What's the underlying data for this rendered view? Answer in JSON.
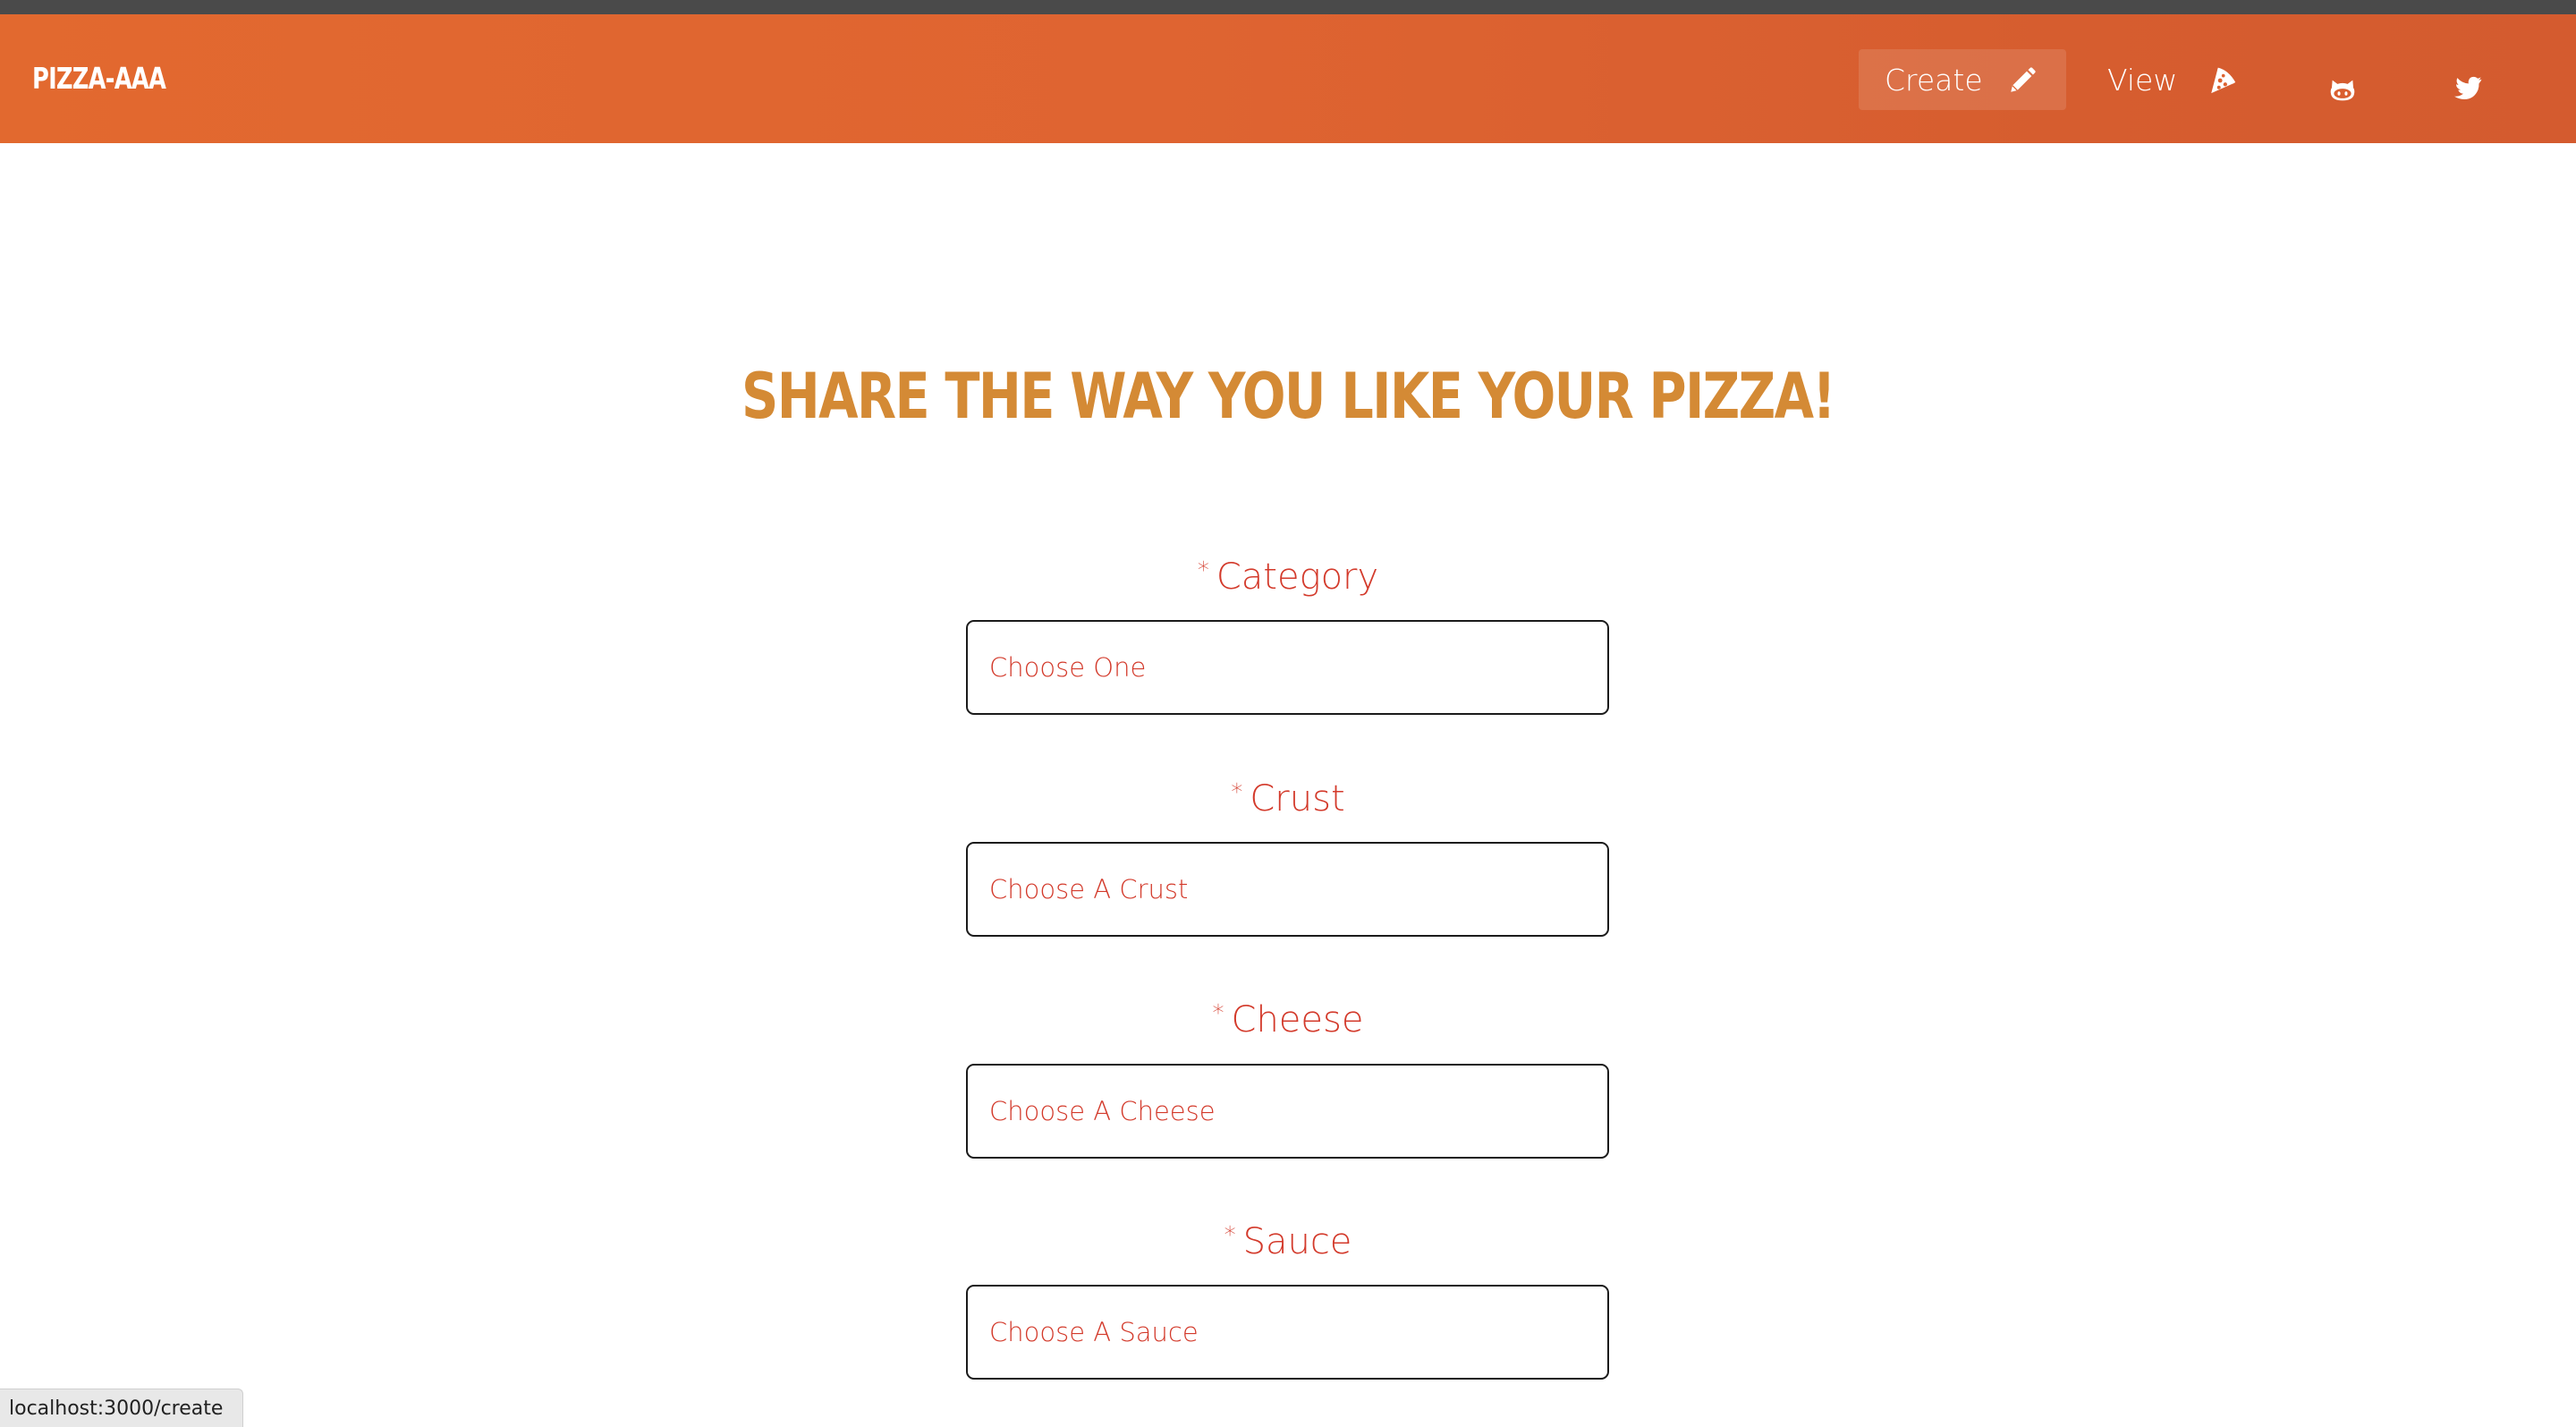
{
  "navbar": {
    "brand": "PIZZA-AAA",
    "create_label": "Create",
    "view_label": "View",
    "icons": {
      "create": "pencil-icon",
      "view": "pizza-slice-icon",
      "github": "github-icon",
      "twitter": "twitter-icon"
    },
    "colors": {
      "bar_start": "#e2692f",
      "bar_end": "#d45b2f",
      "text": "#ffffff"
    }
  },
  "main": {
    "headline": "SHARE THE WAY YOU LIKE YOUR PIZZA!",
    "headline_color": "#d48a35",
    "fields": [
      {
        "required_mark": "*",
        "label": "Category",
        "placeholder": "Choose One"
      },
      {
        "required_mark": "*",
        "label": "Crust",
        "placeholder": "Choose A Crust"
      },
      {
        "required_mark": "*",
        "label": "Cheese",
        "placeholder": "Choose A Cheese"
      },
      {
        "required_mark": "*",
        "label": "Sauce",
        "placeholder": "Choose A Sauce"
      }
    ],
    "field_text_color": "#d33a2b"
  },
  "status_bar": {
    "url": "localhost:3000/create"
  }
}
